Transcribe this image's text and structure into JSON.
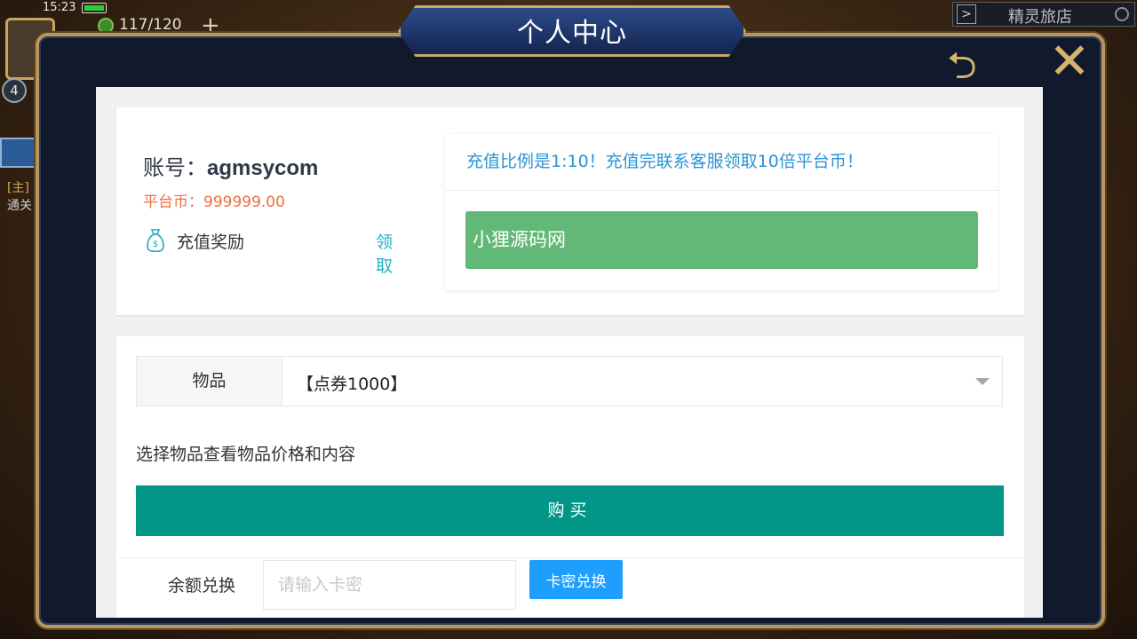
{
  "hud": {
    "time": "15:23",
    "energy": "117/120",
    "energy_plus": "+",
    "level": "4",
    "side_tag": "[主]",
    "side_sub": "通关",
    "shop_title": "精灵旅店",
    "shop_arrow": ">"
  },
  "dialog": {
    "title": "个人中心",
    "back_glyph": "⮌",
    "close_glyph": "✕"
  },
  "account": {
    "label": "账号：",
    "value": "agmsycom",
    "coins_label": "平台币：",
    "coins_value": "999999.00",
    "reward_label": "充值奖励",
    "claim_label": "领取"
  },
  "notice": {
    "text": "充值比例是1:10！充值完联系客服领取10倍平台币！",
    "banner": "小狸源码网"
  },
  "shop": {
    "item_label": "物品",
    "item_selected": "【点券1000】",
    "hint": "选择物品查看物品价格和内容",
    "buy_label": "购买"
  },
  "redeem": {
    "label": "余额兑换",
    "placeholder": "请输入卡密",
    "button": "卡密兑换"
  },
  "colors": {
    "accent_teal": "#019688",
    "accent_blue": "#1e9fff",
    "banner_green": "#62b877",
    "coin_orange": "#f06d3a",
    "notice_blue": "#2b93d6",
    "frame_gold": "#b8955a"
  }
}
